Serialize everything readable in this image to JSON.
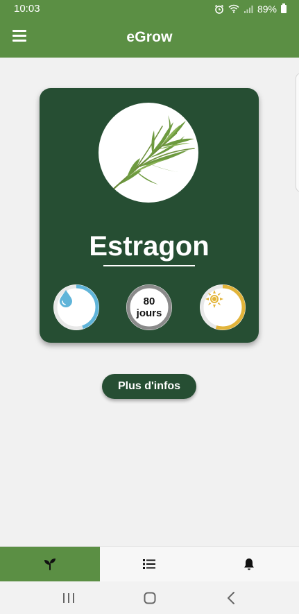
{
  "status_bar": {
    "time": "10:03",
    "battery": "89%",
    "icons": [
      "alarm-icon",
      "wifi-icon",
      "signal-icon",
      "battery-icon"
    ]
  },
  "app_bar": {
    "title": "eGrow",
    "menu_icon": "hamburger-menu-icon"
  },
  "plant": {
    "name": "Estragon",
    "photo": "tarragon-sprig",
    "water_level": 0.45,
    "days_value": "80",
    "days_unit": "jours",
    "days_progress": 1.0,
    "sun_level": 0.55,
    "colors": {
      "card": "#264e33",
      "water": "#5fb4d9",
      "days": "#8a8a8a",
      "sun": "#e2b43a"
    }
  },
  "more_button": {
    "label": "Plus d'infos"
  },
  "bottom_nav": {
    "active_index": 0,
    "tabs": [
      {
        "icon": "sprout-icon"
      },
      {
        "icon": "list-icon"
      },
      {
        "icon": "bell-icon"
      }
    ]
  },
  "system_nav": {
    "buttons": [
      "recents-icon",
      "home-icon",
      "back-icon"
    ]
  },
  "colors": {
    "primary": "#5b8f44",
    "dark": "#264e33",
    "background": "#f1f1f1"
  }
}
